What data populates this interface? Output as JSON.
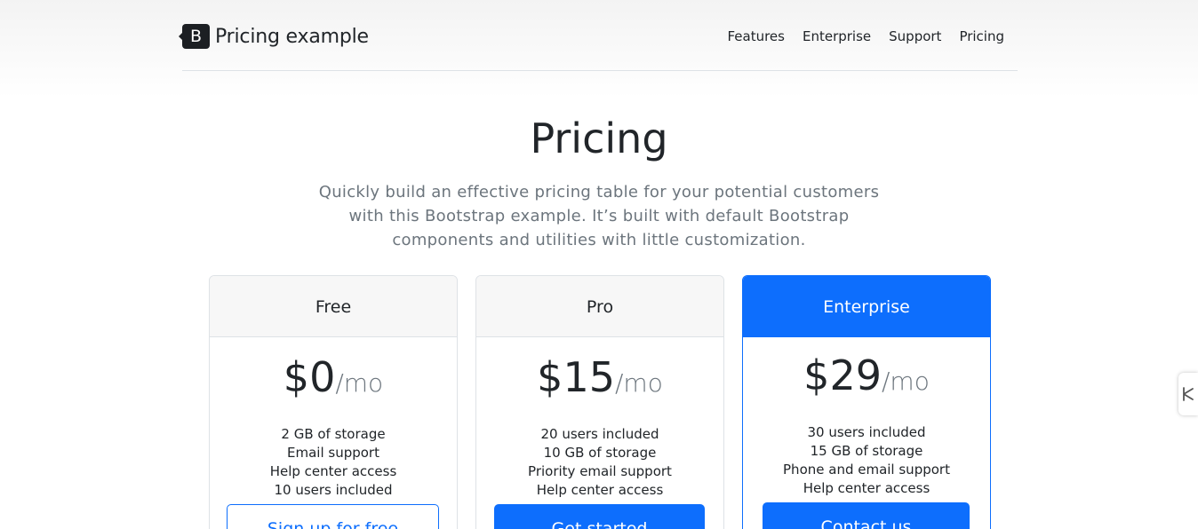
{
  "header": {
    "logo_letter": "B",
    "brand": "Pricing example",
    "nav": [
      "Features",
      "Enterprise",
      "Support",
      "Pricing"
    ]
  },
  "hero": {
    "title": "Pricing",
    "lead": "Quickly build an effective pricing table for your potential customers with this Bootstrap example. It’s built with default Bootstrap components and utilities with little customization."
  },
  "plans": [
    {
      "name": "Free",
      "price": "$0",
      "unit": "/mo",
      "features": [
        "2 GB of storage",
        "Email support",
        "Help center access",
        "10 users included"
      ],
      "button": "Sign up for free"
    },
    {
      "name": "Pro",
      "price": "$15",
      "unit": "/mo",
      "features": [
        "20 users included",
        "10 GB of storage",
        "Priority email support",
        "Help center access"
      ],
      "button": "Get started"
    },
    {
      "name": "Enterprise",
      "price": "$29",
      "unit": "/mo",
      "features": [
        "30 users included",
        "15 GB of storage",
        "Phone and email support",
        "Help center access"
      ],
      "button": "Contact us"
    }
  ],
  "colors": {
    "primary": "#0d6efd",
    "muted": "#6c757d",
    "text": "#212529"
  },
  "side_tab": {
    "icon": "tool-handle-icon"
  }
}
